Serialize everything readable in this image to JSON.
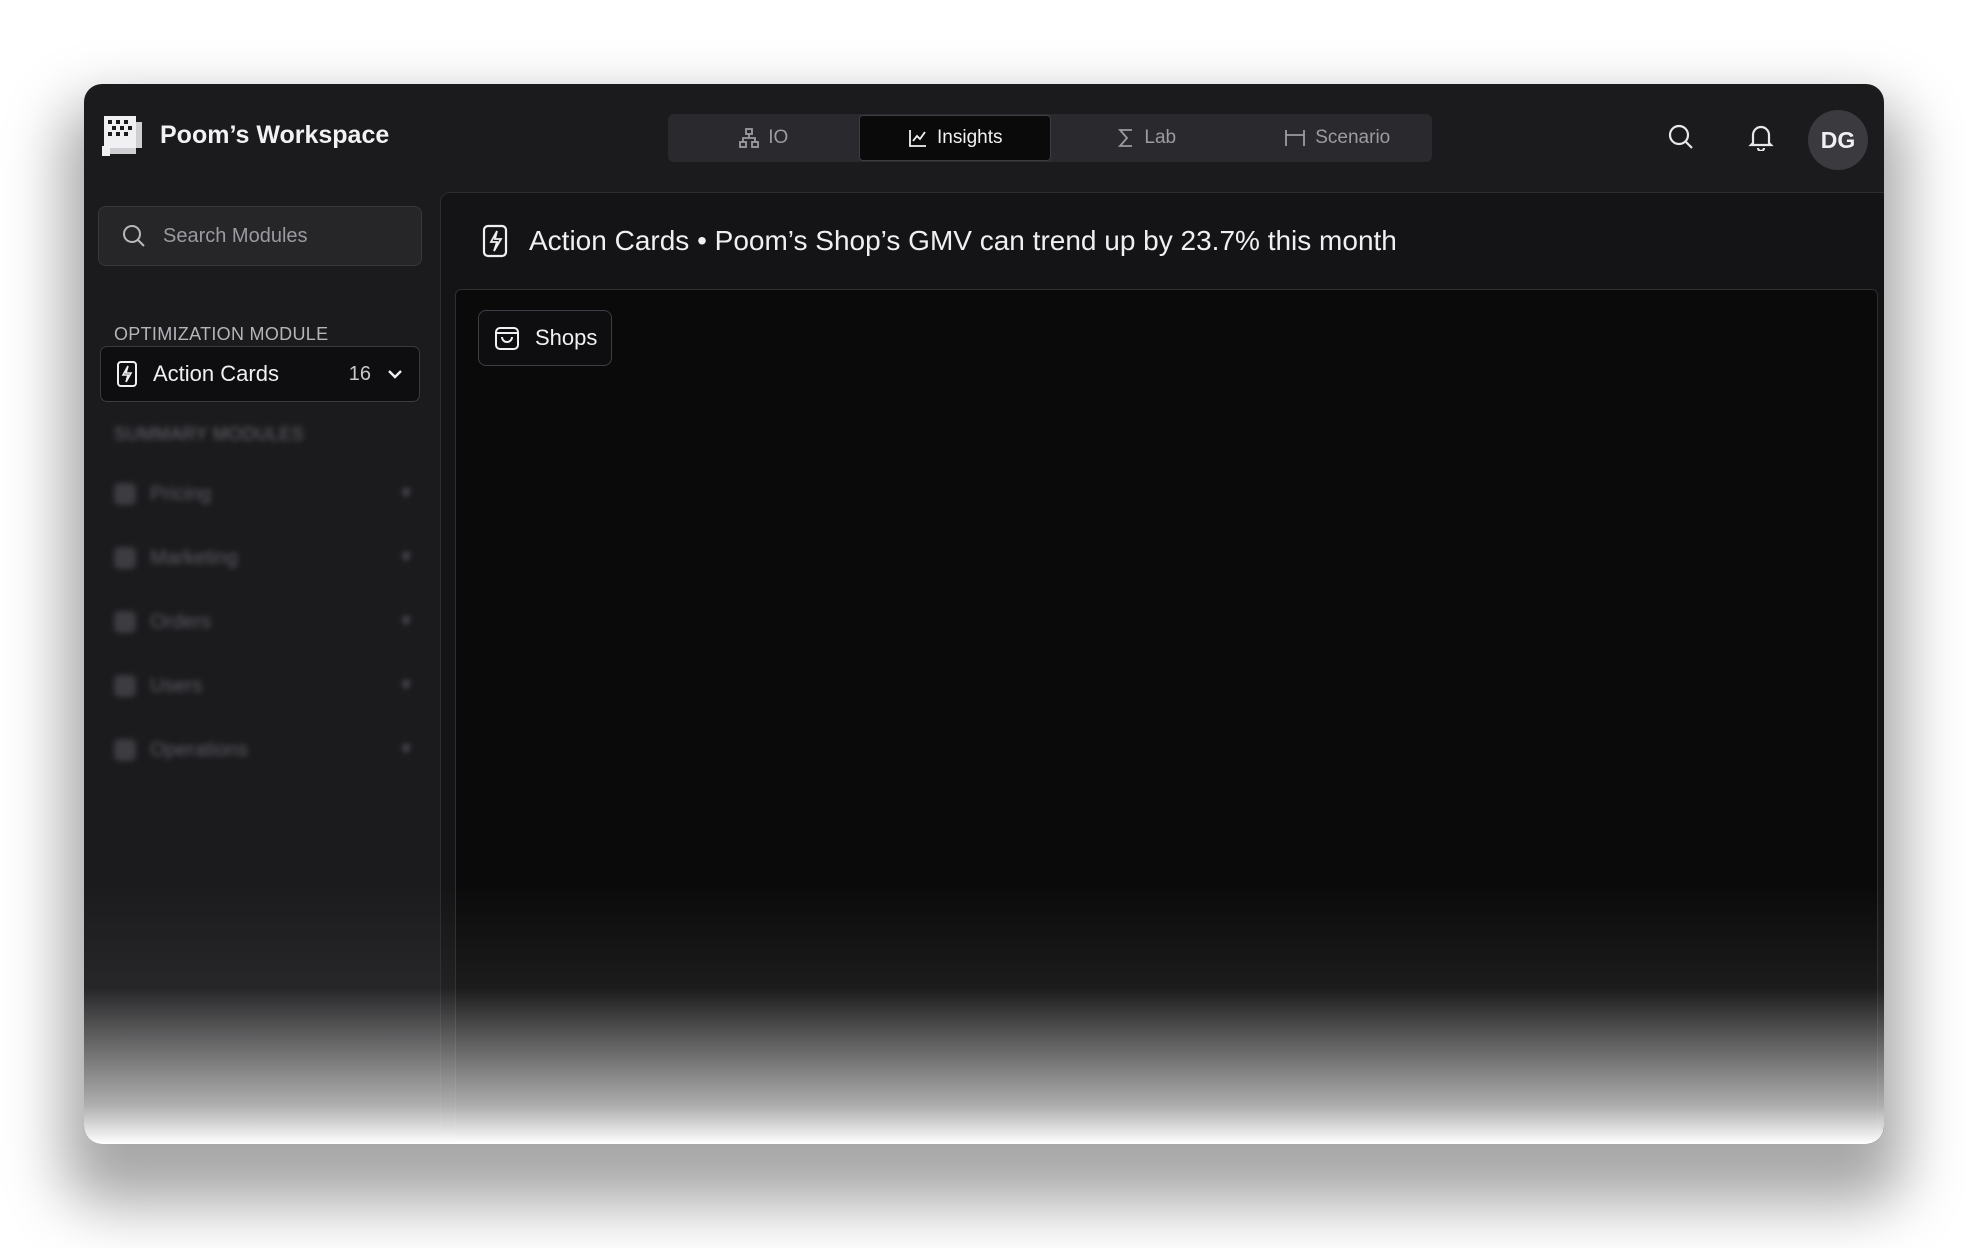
{
  "workspace": {
    "name": "Poom’s Workspace"
  },
  "tabs": [
    {
      "label": "IO",
      "icon": "hierarchy-icon",
      "active": false
    },
    {
      "label": "Insights",
      "icon": "line-chart-icon",
      "active": true
    },
    {
      "label": "Lab",
      "icon": "sigma-icon",
      "active": false
    },
    {
      "label": "Scenario",
      "icon": "bracket-icon",
      "active": false
    }
  ],
  "header": {
    "avatar_initials": "DG"
  },
  "sidebar": {
    "search_placeholder": "Search Modules",
    "optimization_label": "OPTIMIZATION MODULE",
    "action_cards": {
      "label": "Action Cards",
      "count": "16"
    },
    "summary_label": "SUMMARY MODULES",
    "summary_items": [
      {
        "label": "Pricing"
      },
      {
        "label": "Marketing"
      },
      {
        "label": "Orders"
      },
      {
        "label": "Users"
      },
      {
        "label": "Operations"
      }
    ]
  },
  "main": {
    "title": "Action Cards • Poom’s Shop’s GMV can trend up by 23.7% this month",
    "chip_label": "Shops"
  },
  "colors": {
    "background": "#1b1b1e",
    "panel": "#0a0a0b",
    "accent": "#f0f0f2"
  }
}
